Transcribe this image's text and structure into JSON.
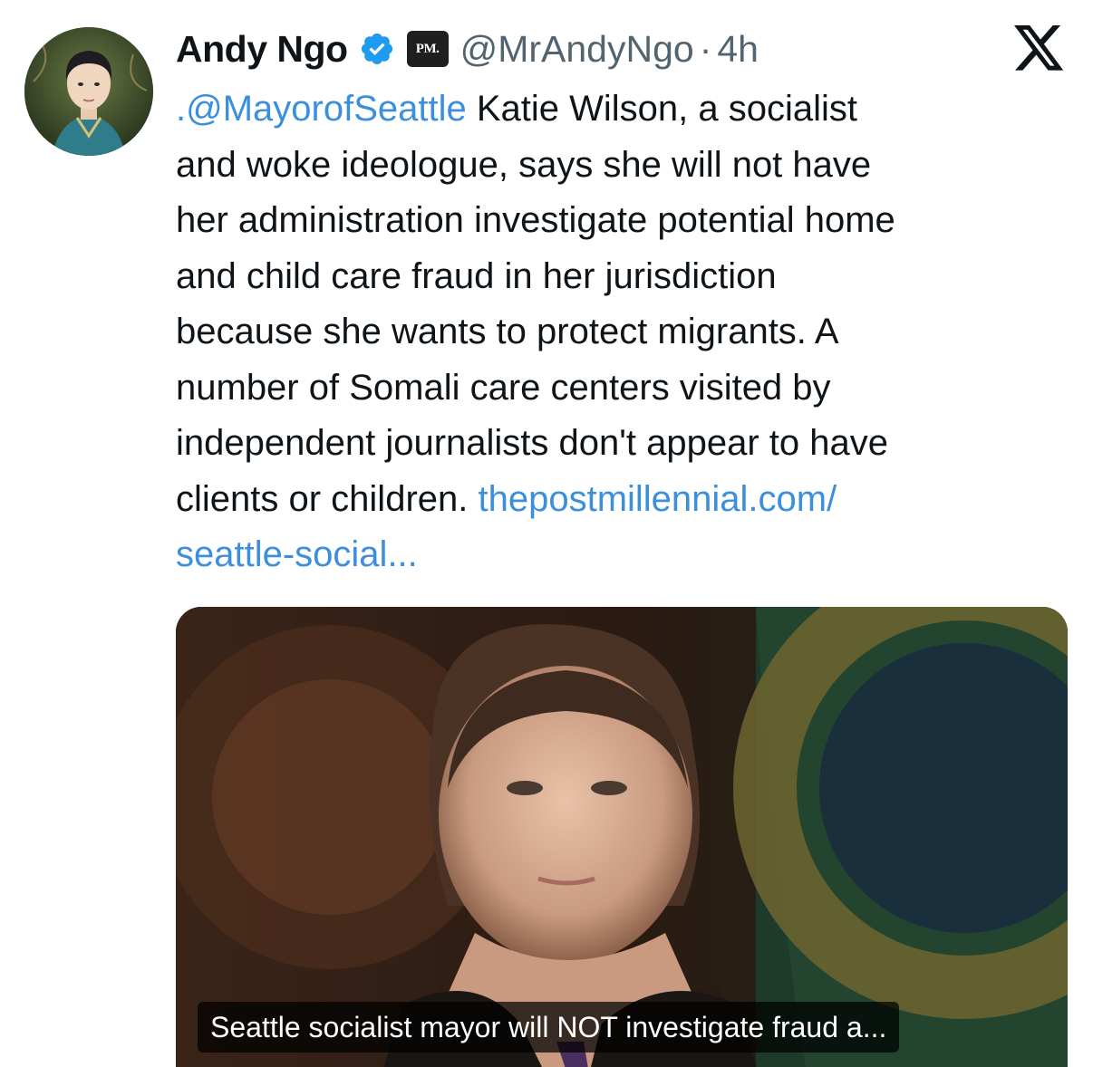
{
  "author": {
    "display_name": "Andy Ngo",
    "handle": "@MrAndyNgo",
    "separator": "·",
    "timestamp": "4h",
    "verified_icon": "verified-badge-icon",
    "affiliation_badge_text": "PM."
  },
  "platform": {
    "logo_icon": "x-logo-icon"
  },
  "tweet": {
    "lines": [
      {
        "mention": ".@MayorofSeattle",
        "text": " Katie Wilson, a socialist"
      },
      {
        "text": "and woke ideologue, says she will not have"
      },
      {
        "text": "her administration investigate potential home"
      },
      {
        "text": "and child care fraud in her jurisdiction"
      },
      {
        "text": "because she wants to protect migrants. A"
      },
      {
        "text": "number of Somali care centers visited by"
      },
      {
        "text": "independent journalists don't appear to have"
      },
      {
        "text": "clients or children. ",
        "link": "thepostmillennial.com/"
      },
      {
        "link": "seattle-social..."
      }
    ]
  },
  "media": {
    "caption": "Seattle socialist mayor will NOT investigate fraud a..."
  },
  "colors": {
    "link": "#3b8fdb",
    "verified": "#1d9bf0",
    "text": "#0f1419",
    "muted": "#536471"
  }
}
